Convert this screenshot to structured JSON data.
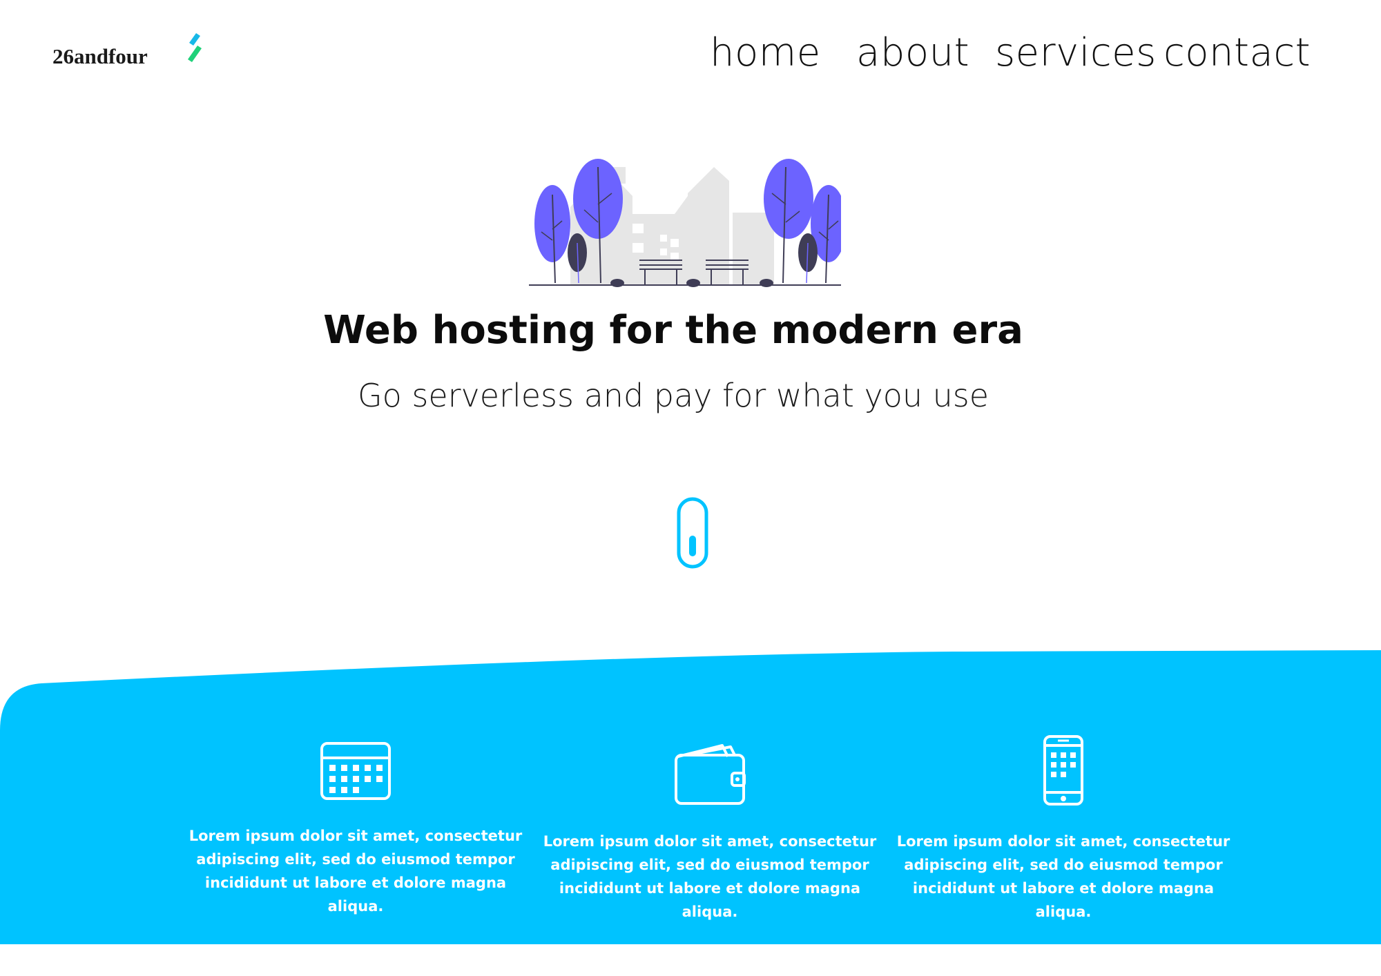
{
  "brand": {
    "name": "26andfour"
  },
  "nav": {
    "items": [
      {
        "label": "home"
      },
      {
        "label": "about"
      },
      {
        "label": "services"
      },
      {
        "label": "contact"
      }
    ]
  },
  "hero": {
    "title": "Web hosting for the modern era",
    "subtitle": "Go serverless and pay for what you use"
  },
  "features": [
    {
      "icon": "calendar-icon",
      "text": "Lorem ipsum dolor sit amet, consectetur adipiscing elit, sed do eiusmod tempor incididunt ut labore et dolore magna aliqua."
    },
    {
      "icon": "wallet-icon",
      "text": "Lorem ipsum dolor sit amet, consectetur adipiscing elit, sed do eiusmod tempor incididunt ut labore et dolore magna aliqua."
    },
    {
      "icon": "smartphone-icon",
      "text": "Lorem ipsum dolor sit amet, consectetur adipiscing elit, sed do eiusmod tempor incididunt ut labore et dolore magna aliqua."
    }
  ],
  "colors": {
    "accent": "#00c3ff",
    "tree": "#6c63ff",
    "logo_mark": [
      "#00c3ff",
      "#1fd17a"
    ]
  }
}
